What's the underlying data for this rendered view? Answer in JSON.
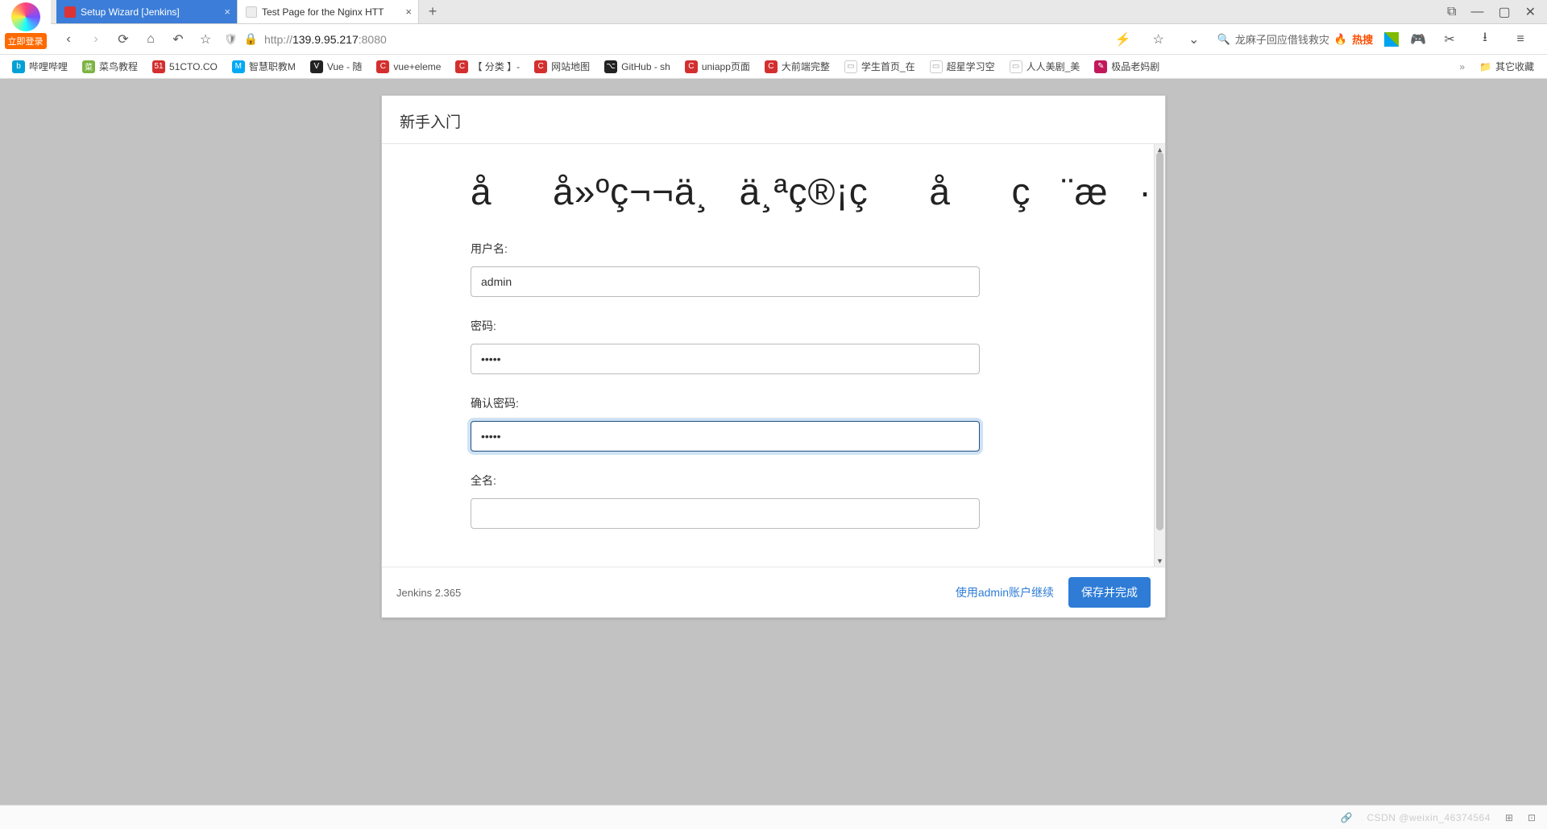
{
  "sidebar": {
    "login_label": "立即登录"
  },
  "tabs": {
    "items": [
      {
        "title": "Setup Wizard [Jenkins]"
      },
      {
        "title": "Test Page for the Nginx HTT"
      }
    ]
  },
  "window_controls": {
    "ext": "⧉",
    "min": "—",
    "max": "▢",
    "close": "✕"
  },
  "nav": {
    "back": "‹",
    "forward": "›",
    "reload": "⟳",
    "home": "⌂",
    "undo": "↶",
    "star": "☆"
  },
  "address": {
    "shield": "🛡",
    "lock": "🔒",
    "scheme": "http://",
    "host": "139.9.95.217",
    "port": ":8080"
  },
  "addr_right": {
    "bolt": "⚡",
    "star": "☆",
    "chev": "⌄",
    "search_icon": "🔍",
    "search_placeholder": "龙麻子回应借钱救灾",
    "hot_label": "热搜",
    "scissors": "✂",
    "down": "⭳",
    "menu": "≡"
  },
  "bookmarks": {
    "items": [
      {
        "label": "哔哩哔哩",
        "color": "#00a1d6"
      },
      {
        "label": "菜鸟教程",
        "color": "#7cb342"
      },
      {
        "label": "51CTO.CO",
        "color": "#d32f2f"
      },
      {
        "label": "智慧职教M",
        "color": "#03a9f4"
      },
      {
        "label": "Vue - 随",
        "color": "#222"
      },
      {
        "label": "vue+eleme",
        "color": "#d32f2f"
      },
      {
        "label": "【 分类 】-",
        "color": "#d32f2f"
      },
      {
        "label": "网站地图",
        "color": "#d32f2f"
      },
      {
        "label": "GitHub - sh",
        "color": "#222"
      },
      {
        "label": "uniapp页面",
        "color": "#d32f2f"
      },
      {
        "label": "大前端完整",
        "color": "#d32f2f"
      },
      {
        "label": "学生首页_在",
        "color": "#999"
      },
      {
        "label": "超星学习空",
        "color": "#999"
      },
      {
        "label": "人人美剧_美",
        "color": "#999"
      },
      {
        "label": "极品老妈剧",
        "color": "#c2185b"
      }
    ],
    "overflow": "»",
    "folder_label": "其它收藏"
  },
  "modal": {
    "header": "新手入门",
    "heading": "åå»ºç¬¬ä¸ä¸ªç®¡çåç¨æ·",
    "labels": {
      "username": "用户名:",
      "password": "密码:",
      "confirm": "确认密码:",
      "fullname": "全名:"
    },
    "values": {
      "username": "admin",
      "password": "•••••",
      "confirm": "•••••",
      "fullname": ""
    },
    "footer": {
      "version": "Jenkins 2.365",
      "skip_link": "使用admin账户继续",
      "save_btn": "保存并完成"
    }
  },
  "status": {
    "watermark": "CSDN @weixin_46374564",
    "link": "🔗",
    "sq1": "⊞",
    "sq2": "⊡"
  }
}
